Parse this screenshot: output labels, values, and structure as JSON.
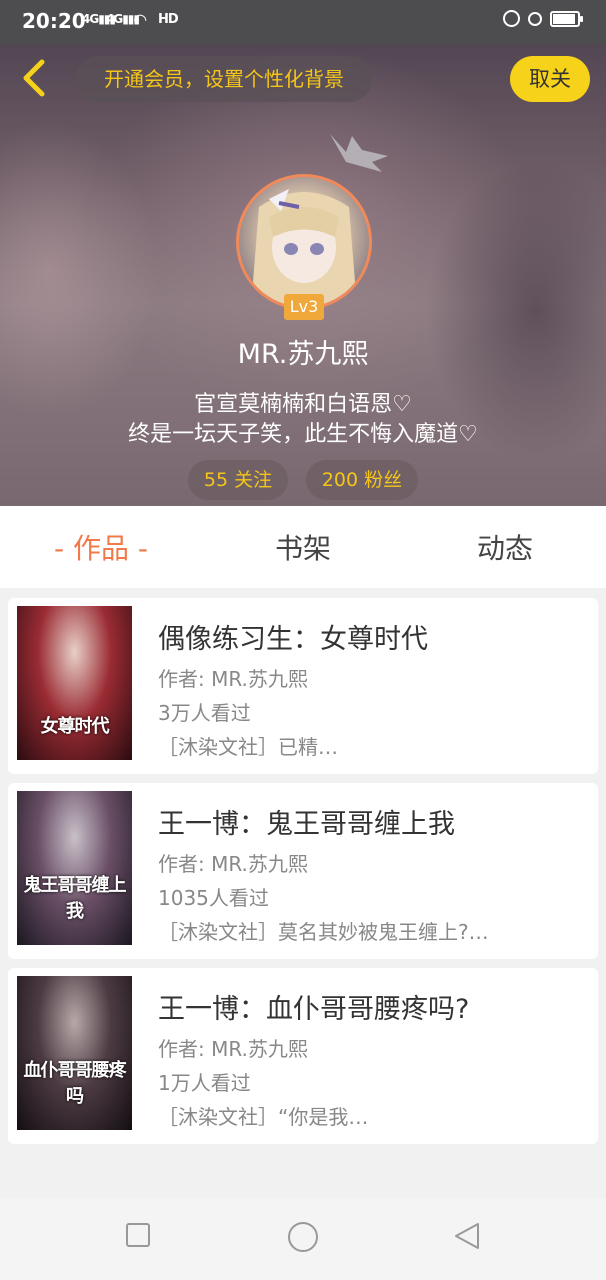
{
  "status_bar": {
    "time": "20:20",
    "signal1": "4G",
    "signal2": "4G",
    "hd": "HD"
  },
  "header": {
    "vip_prompt": "开通会员，设置个性化背景",
    "cancel_follow": "取关"
  },
  "profile": {
    "level": "Lv3",
    "username": "MR.苏九熙",
    "bio_line1": "官宣莫楠楠和白语恩♡",
    "bio_line2": "终是一坛天子笑，此生不悔入魔道♡",
    "following": "55 关注",
    "fans": "200 粉丝"
  },
  "tabs": {
    "works": "作品",
    "shelf": "书架",
    "feed": "动态",
    "dash": "-"
  },
  "books": [
    {
      "title": "偶像练习生：女尊时代",
      "author": "作者: MR.苏九熙",
      "views": "3万人看过",
      "desc": "［沐染文社］已精…",
      "cover_text": "女尊时代"
    },
    {
      "title": "王一博：鬼王哥哥缠上我",
      "author": "作者: MR.苏九熙",
      "views": "1035人看过",
      "desc": "［沐染文社］莫名其妙被鬼王缠上?…",
      "cover_text": "鬼王哥哥缠上我"
    },
    {
      "title": "王一博：血仆哥哥腰疼吗?",
      "author": "作者: MR.苏九熙",
      "views": "1万人看过",
      "desc": "［沐染文社］“你是我…",
      "cover_text": "血仆哥哥腰疼吗"
    }
  ],
  "colors": {
    "accent": "#f07a4a",
    "vip_yellow": "#f5c518",
    "cancel_bg": "#f7d21a"
  },
  "icons": {
    "back": "back-arrow-icon",
    "crown": "crown-icon",
    "nav_recent": "square-icon",
    "nav_home": "circle-icon",
    "nav_back": "triangle-back-icon"
  }
}
